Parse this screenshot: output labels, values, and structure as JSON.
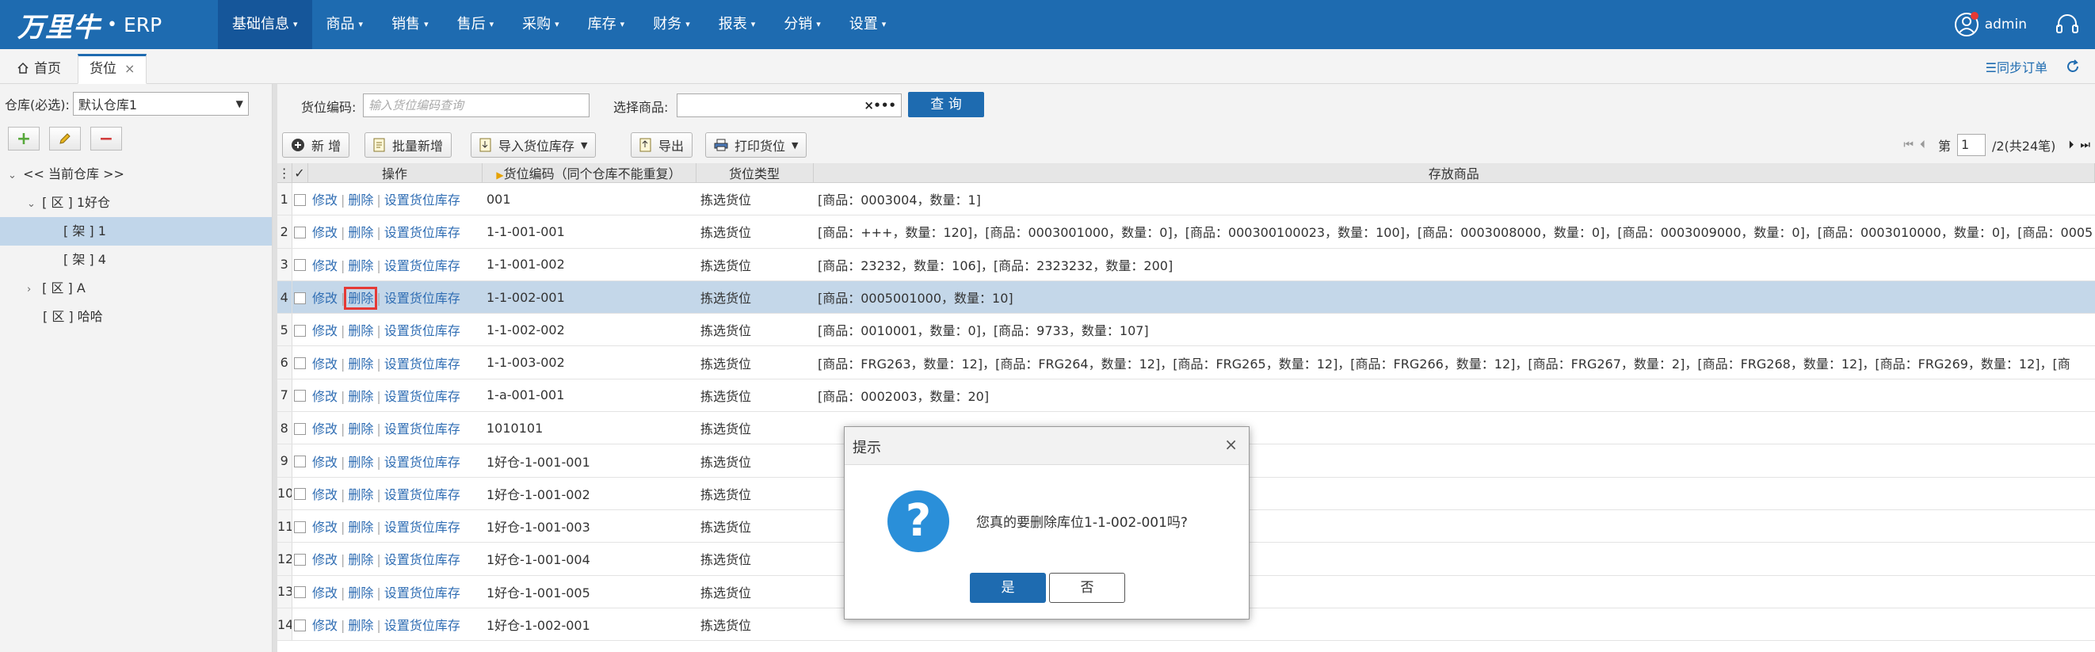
{
  "nav": {
    "brand": "万里牛",
    "product": "ERP",
    "menu": [
      {
        "label": "基础信息",
        "active": true
      },
      {
        "label": "商品"
      },
      {
        "label": "销售"
      },
      {
        "label": "售后"
      },
      {
        "label": "采购"
      },
      {
        "label": "库存"
      },
      {
        "label": "财务"
      },
      {
        "label": "报表"
      },
      {
        "label": "分销"
      },
      {
        "label": "设置"
      }
    ],
    "user": "admin"
  },
  "tabs": {
    "home": "首页",
    "current": "货位",
    "sync": "同步订单"
  },
  "left": {
    "warehouse_label": "仓库(必选):",
    "warehouse_value": "默认仓库1",
    "tree": [
      {
        "label": "<< 当前仓库 >>",
        "indent": 0,
        "arrow": "⌄"
      },
      {
        "label": "[ 区 ] 1好仓",
        "indent": 1,
        "arrow": "⌄"
      },
      {
        "label": "[ 架 ] 1",
        "indent": 3,
        "arrow": "",
        "selected": true
      },
      {
        "label": "[ 架 ] 4",
        "indent": 3,
        "arrow": ""
      },
      {
        "label": "[ 区 ] A",
        "indent": 1,
        "arrow": "›"
      },
      {
        "label": "[ 区 ] 哈哈",
        "indent": 2,
        "arrow": ""
      }
    ]
  },
  "filter": {
    "code_label": "货位编码:",
    "code_placeholder": "输入货位编码查询",
    "goods_label": "选择商品:",
    "query_btn": "查 询"
  },
  "toolbar": {
    "add": "新 增",
    "batch_add": "批量新增",
    "import": "导入货位库存",
    "export": "导出",
    "print": "打印货位",
    "page_label": "第",
    "page_value": "1",
    "page_total": "/2(共24笔)"
  },
  "grid": {
    "headers": {
      "ops": "操作",
      "code": "货位编码（同个仓库不能重复）",
      "type": "货位类型",
      "goods": "存放商品"
    },
    "op_edit": "修改",
    "op_delete": "删除",
    "op_set": "设置货位库存",
    "rows": [
      {
        "n": "1",
        "code": "001",
        "type": "拣选货位",
        "goods": "[商品：0003004，数量：1]"
      },
      {
        "n": "2",
        "code": "1-1-001-001",
        "type": "拣选货位",
        "goods": "[商品：+++，数量：120]，[商品：0003001000，数量：0]，[商品：000300100023，数量：100]，[商品：0003008000，数量：0]，[商品：0003009000，数量：0]，[商品：0003010000，数量：0]，[商品：0005"
      },
      {
        "n": "3",
        "code": "1-1-001-002",
        "type": "拣选货位",
        "goods": "[商品：23232，数量：106]，[商品：2323232，数量：200]"
      },
      {
        "n": "4",
        "code": "1-1-002-001",
        "type": "拣选货位",
        "goods": "[商品：0005001000，数量：10]",
        "highlight": true
      },
      {
        "n": "5",
        "code": "1-1-002-002",
        "type": "拣选货位",
        "goods": "[商品：0010001，数量：0]，[商品：9733，数量：107]"
      },
      {
        "n": "6",
        "code": "1-1-003-002",
        "type": "拣选货位",
        "goods": "[商品：FRG263，数量：12]，[商品：FRG264，数量：12]，[商品：FRG265，数量：12]，[商品：FRG266，数量：12]，[商品：FRG267，数量：2]，[商品：FRG268，数量：12]，[商品：FRG269，数量：12]，[商"
      },
      {
        "n": "7",
        "code": "1-a-001-001",
        "type": "拣选货位",
        "goods": "[商品：0002003，数量：20]"
      },
      {
        "n": "8",
        "code": "1010101",
        "type": "拣选货位",
        "goods": ""
      },
      {
        "n": "9",
        "code": "1好仓-1-001-001",
        "type": "拣选货位",
        "goods": ""
      },
      {
        "n": "10",
        "code": "1好仓-1-001-002",
        "type": "拣选货位",
        "goods": ""
      },
      {
        "n": "11",
        "code": "1好仓-1-001-003",
        "type": "拣选货位",
        "goods": ""
      },
      {
        "n": "12",
        "code": "1好仓-1-001-004",
        "type": "拣选货位",
        "goods": ""
      },
      {
        "n": "13",
        "code": "1好仓-1-001-005",
        "type": "拣选货位",
        "goods": ""
      },
      {
        "n": "14",
        "code": "1好仓-1-002-001",
        "type": "拣选货位",
        "goods": ""
      }
    ]
  },
  "dialog": {
    "title": "提示",
    "message": "您真的要删除库位1-1-002-001吗?",
    "yes": "是",
    "no": "否"
  },
  "colors": {
    "brand": "#1e6bb0",
    "row_highlight": "#c4d7e9",
    "link": "#2f6db3"
  }
}
